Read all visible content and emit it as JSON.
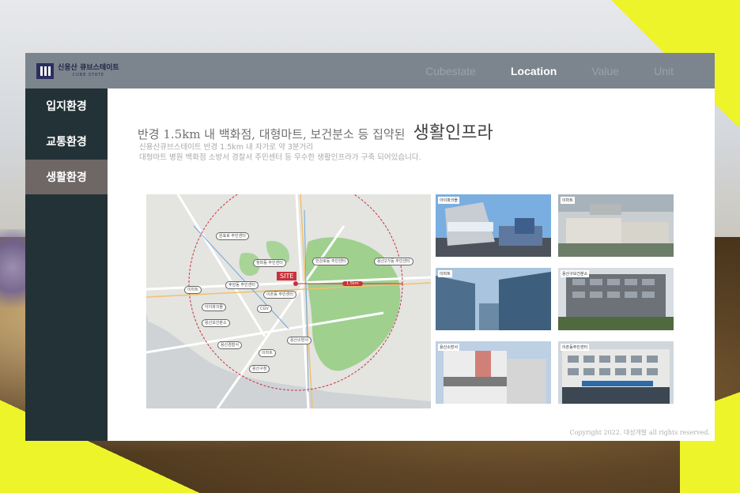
{
  "header": {
    "logo_name": "신용산 큐브스테이트",
    "logo_sub": "CUBE STATE",
    "nav": [
      {
        "label": "Cubestate",
        "active": false
      },
      {
        "label": "Location",
        "active": true
      },
      {
        "label": "Value",
        "active": false
      },
      {
        "label": "Unit",
        "active": false
      }
    ]
  },
  "sidebar": {
    "items": [
      {
        "label": "입지환경",
        "active": false
      },
      {
        "label": "교통환경",
        "active": false
      },
      {
        "label": "생활환경",
        "active": true
      }
    ]
  },
  "content": {
    "headline_main": "반경 1.5km 내 백화점, 대형마트, 보건분소 등 집약된",
    "headline_strong": "생활인프라",
    "desc_line1": "신용산큐브스테이트 반경 1.5km 내 자가로 약 3분거리",
    "desc_line2": "대형마트 병원 백화점 소방서 경찰서 주민센터 등 우수한 생활인프라가 구축 되어있습니다.",
    "map": {
      "site_label": "SITE",
      "distance_label": "1.5km",
      "labels": [
        "원효로 주민센터",
        "청파동 주민센터",
        "한강로동 주민센터",
        "용산2가동 주민센터",
        "이마트",
        "후암동 주민센터",
        "이촌동 주민센터",
        "아이파크몰",
        "CGV",
        "용산보건분소",
        "용산경찰서",
        "용산소방서",
        "이마트",
        "용산구청"
      ]
    },
    "photos": [
      {
        "caption": "아이파크몰"
      },
      {
        "caption": "이마트"
      },
      {
        "caption": "이마트"
      },
      {
        "caption": "용산구보건분소"
      },
      {
        "caption": "용산소방서"
      },
      {
        "caption": "이촌동주민센터"
      }
    ],
    "copyright": "Copyright 2022. 대성개발 all rights reserved."
  },
  "colors": {
    "topbar": "#7c858d",
    "sidebar": "#233237",
    "sidebar_active": "#6e6766",
    "accent_yellow": "#eef42a",
    "site_red": "#c8323a"
  }
}
